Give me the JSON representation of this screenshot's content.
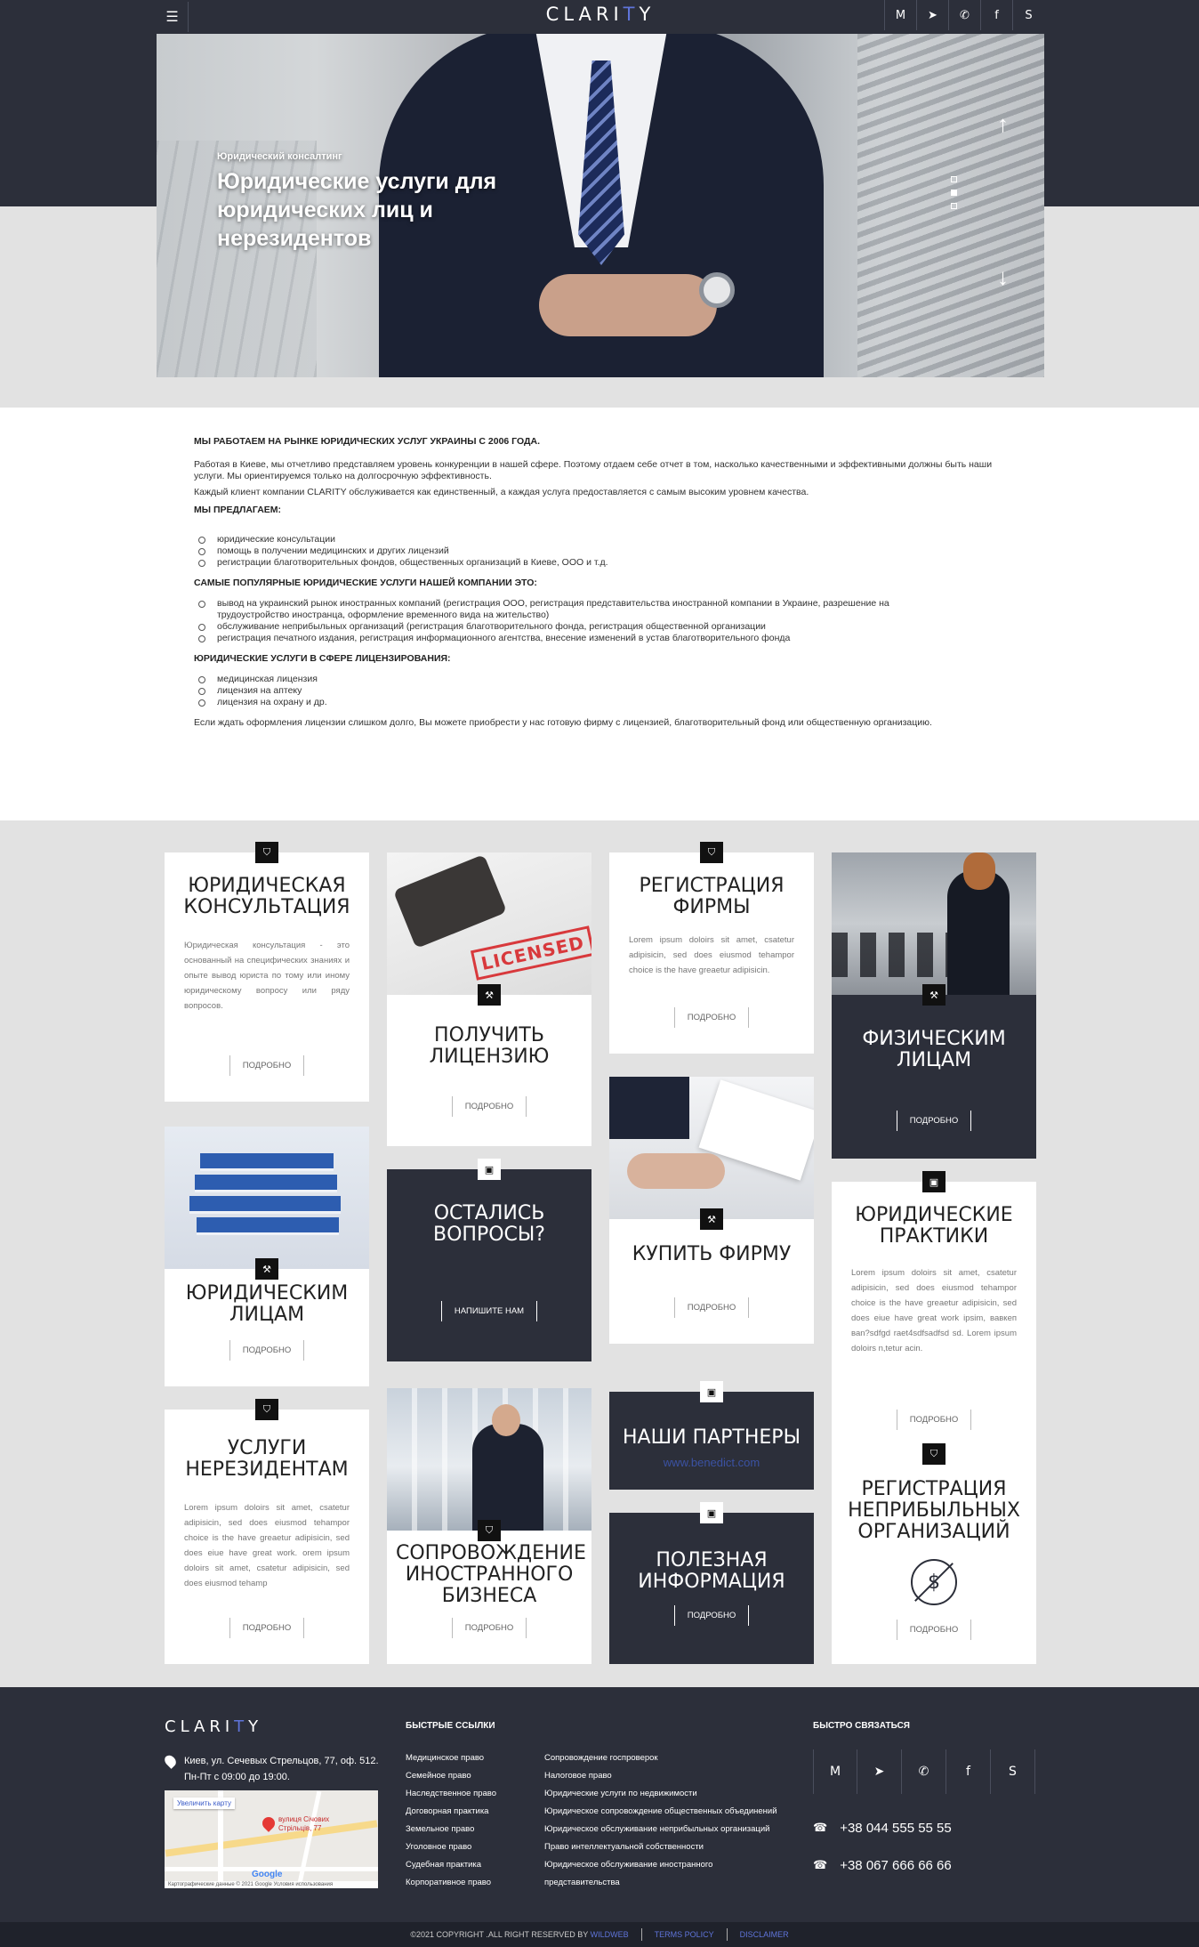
{
  "header": {
    "logo_pre": "CLARI",
    "logo_accent": "T",
    "logo_post": "Y",
    "menu_icon": "hamburger-icon",
    "social": [
      "gmail-icon",
      "telegram-icon",
      "viber-icon",
      "facebook-icon",
      "skype-icon"
    ]
  },
  "hero": {
    "kicker": "Юридический консалтинг",
    "title": "Юридические услуги для юридических лиц и нерезидентов"
  },
  "about": {
    "h1": "МЫ РАБОТАЕМ НА РЫНКЕ ЮРИДИЧЕСКИХ УСЛУГ УКРАИНЫ С 2006 ГОДА.",
    "p1": "Работая в Киеве, мы отчетливо представляем уровень конкуренции в нашей сфере. Поэтому отдаем себе отчет в том, насколько качественными и эффективными должны быть наши услуги. Мы ориентируемся только на долгосрочную эффективность.",
    "p2": "Каждый клиент компании CLARITY обслуживается как единственный, а каждая услуга предоставляется с самым высоким уровнем качества.",
    "h2": "МЫ ПРЕДЛАГАЕМ:",
    "list1": [
      "юридические консультации",
      "помощь в получении медицинских и других лицензий",
      "регистрации благотворительных фондов, общественных организаций в Киеве, ООО и т.д."
    ],
    "h3": "САМЫЕ ПОПУЛЯРНЫЕ ЮРИДИЧЕСКИЕ УСЛУГИ НАШЕЙ КОМПАНИИ ЭТО:",
    "list2": [
      "вывод на украинский рынок иностранных компаний (регистрация ООО, регистрация представительства иностранной компании в Украине, разрешение на трудоустройство иностранца, оформление временного вида на жительство)",
      "обслуживание неприбыльных организаций (регистрация благотворительного фонда, регистрация общественной организации",
      "регистрация печатного издания, регистрация информационного агентства, внесение изменений в устав благотворительного фонда"
    ],
    "h4": "ЮРИДИЧЕСКИЕ УСЛУГИ В СФЕРЕ ЛИЦЕНЗИРОВАНИЯ:",
    "list3": [
      "медицинская лицензия",
      "лицензия на аптеку",
      "лицензия на охрану и др."
    ],
    "p3": "Если ждать оформления лицензии слишком долго, Вы можете приобрести у нас готовую фирму с лицензией, благотворительный фонд или общественную организацию."
  },
  "cards": {
    "more": "ПОДРОБНО",
    "c1": {
      "title": "ЮРИДИЧЕСКАЯ КОНСУЛЬТАЦИЯ",
      "text": "Юридическая консультация - это основанный на специфических знаниях и опыте вывод юриста по тому или иному юридическому вопросу или ряду вопросов."
    },
    "c2": {
      "title": "ПОЛУЧИТЬ ЛИЦЕНЗИЮ",
      "stamp": "LICENSED"
    },
    "c3": {
      "title": "РЕГИСТРАЦИЯ ФИРМЫ",
      "text": "Lorem ipsum doloirs sit amet, csatetur adipisicin, sed does eiusmod tehampor choice is the have greaetur adipisicin."
    },
    "c4": {
      "title": "ФИЗИЧЕСКИМ ЛИЦАМ"
    },
    "c5": {
      "title": "ЮРИДИЧЕСКИМ ЛИЦАМ"
    },
    "c6": {
      "title": "ОСТАЛИСЬ ВОПРОСЫ?",
      "button": "НАПИШИТЕ НАМ"
    },
    "c7": {
      "title": "КУПИТЬ ФИРМУ"
    },
    "c8": {
      "title": "ЮРИДИЧЕСКИЕ ПРАКТИКИ",
      "text": "Lorem ipsum doloirs sit amet, csatetur adipisicin, sed does eiusmod tehampor choice is the have greaetur adipisicin, sed does eiue have great work ipsim, вавкеп ваn?sdfgd raet4sdfsadfsd sd. Lorem ipsum doloirs n,tetur acin."
    },
    "c9": {
      "title": "УСЛУГИ НЕРЕЗИДЕНТАМ",
      "text": "Lorem ipsum doloirs sit amet, csatetur adipisicin, sed does eiusmod tehampor choice is the have greaetur adipisicin, sed does eiue have great work. orem ipsum doloirs sit amet, csatetur adipisicin, sed does eiusmod tehamp"
    },
    "c10": {
      "title": "СОПРОВОЖДЕНИЕ ИНОСТРАННОГО БИЗНЕСА"
    },
    "c11": {
      "title": "НАШИ ПАРТНЕРЫ",
      "link": "www.benedict.com"
    },
    "c12": {
      "title": "ПОЛЕЗНАЯ ИНФОРМАЦИЯ"
    },
    "c13": {
      "title": "РЕГИСТРАЦИЯ НЕПРИБЫЛЬНЫХ ОРГАНИЗАЦИЙ"
    }
  },
  "footer": {
    "address_line1": "Киев, ул. Сечевых Стрельцов, 77, оф. 512.",
    "address_line2": "Пн-Пт с 09:00 до 19:00.",
    "map_button": "Увеличить карту",
    "map_street": "вулиця Січових Стрільців, 77",
    "map_copy": "Картографические данные © 2021 Google   Условия использования",
    "map_google": "Google",
    "quick_title": "БЫСТРЫЕ ССЫЛКИ",
    "links1": [
      "Медицинское право",
      "Семейное право",
      "Наследственное право",
      "Договорная практика",
      "Земельное право",
      "Уголовное право",
      "Судебная практика",
      "Корпоративное право"
    ],
    "links2": [
      "Сопровождение госпроверок",
      "Налоговое право",
      "Юридические услуги по недвижимости",
      "Юридическое сопровождение общественных объединений",
      "Юридическое обслуживание неприбыльных организаций",
      "Право интеллектуальной собственности",
      "Юридическое обслуживание иностранного",
      "представительства"
    ],
    "contact_title": "БЫСТРО СВЯЗАТЬСЯ",
    "phone1": "+38 044 555 55 55",
    "phone2": "+38 067 666 66 66"
  },
  "bottom": {
    "copyright": "©2021 COPYRIGHT .ALL RIGHT RESERVED BY",
    "brand": "WILDWEB",
    "terms": "TERMS POLICY",
    "disclaimer": "DISCLAIMER"
  }
}
